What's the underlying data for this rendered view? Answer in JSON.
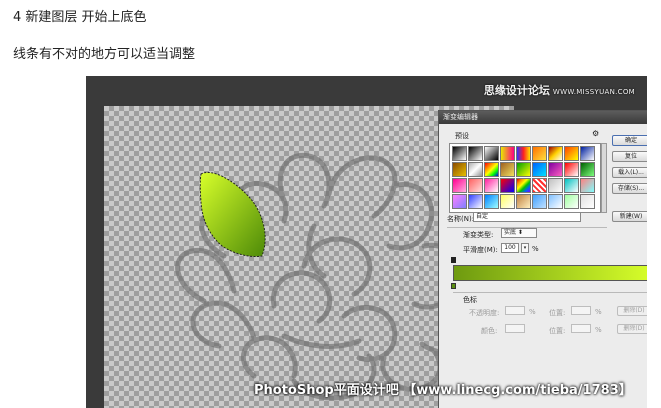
{
  "article": {
    "step_title": "4 新建图层 开始上底色",
    "step_desc": "线条有不对的地方可以适当调整"
  },
  "watermarks": {
    "top_main": "思缘设计论坛",
    "top_sub": "WWW.MISSYUAN.COM",
    "bottom": "PhotoShop平面设计吧 【www.linecg.com/tieba/1783】"
  },
  "dialog": {
    "title": "渐变编辑器",
    "presets_label": "预设",
    "gear_icon": "gear-icon",
    "preset_swatches": [
      "linear-gradient(135deg,#000,#fff)",
      "linear-gradient(135deg,#000,#ffffff00)",
      "linear-gradient(135deg,#fff,#000)",
      "linear-gradient(90deg,#e8e800,#ff0080)",
      "linear-gradient(90deg,#3030ff,#ff2020,#ffe000)",
      "linear-gradient(135deg,#ff7000,#ffe040)",
      "linear-gradient(135deg,#a00000,#ffd000,#ffffff)",
      "linear-gradient(135deg,#ff4000,#ffff00)",
      "linear-gradient(135deg,#0020a0,#ffffff)",
      "linear-gradient(135deg,#8a4a00,#e8c000)",
      "linear-gradient(135deg,#b0b0b0,#ffffff,#909090)",
      "linear-gradient(135deg,#ff0000,#ff8000,#ffff00,#00ff00,#0000ff)",
      "linear-gradient(135deg,#a06020,#f0e060)",
      "linear-gradient(135deg,#00a000,#ffff00)",
      "linear-gradient(135deg,#0060ff,#00e0ff)",
      "linear-gradient(135deg,#8000a0,#ff60c0)",
      "linear-gradient(135deg,#ff0000,#ffffff)",
      "linear-gradient(135deg,#006000,#80ff80)",
      "linear-gradient(135deg,#ff0090,#ffb0e0)",
      "linear-gradient(135deg,#ff6060,#ffe0e0)",
      "linear-gradient(135deg,#ff20a0,#ffffff)",
      "linear-gradient(135deg,#ff0000,#0000ff)",
      "linear-gradient(135deg,#e00000,#ff9000,#ffff00,#00c000,#0060ff,#8000ff)",
      "repeating-linear-gradient(45deg,#ff3030 0 2px,#ffffff 2px 4px)",
      "linear-gradient(135deg,#c0c0c0,#ffffff)",
      "linear-gradient(135deg,#00c0c0,#ffffff)",
      "linear-gradient(135deg,#ff8080,#80ffff)",
      "linear-gradient(135deg,#ff80ff,#8080ff)",
      "linear-gradient(135deg,#3040ff,#ffffff)",
      "linear-gradient(135deg,#0080ff,#a0ffff)",
      "linear-gradient(135deg,#ffff60,#ffffff)",
      "linear-gradient(135deg,#c08040,#fff0c0)",
      "linear-gradient(135deg,#40a0ff,#c0e0ff)",
      "linear-gradient(135deg,#80c0ff,#ffffff)",
      "linear-gradient(135deg,#a0ffa0,#ffffff)",
      "linear-gradient(135deg,#e0e0e0,#ffffff)"
    ],
    "buttons": {
      "ok": "确定",
      "cancel": "复位",
      "load": "载入(L)...",
      "save": "存储(S)...",
      "new": "新建(W)"
    },
    "name_label": "名称(N):",
    "name_value": "自定",
    "gradient_type_label": "渐变类型:",
    "gradient_type_value": "实底 ⬍",
    "smoothness_label": "平滑度(M):",
    "smoothness_value": "100",
    "smoothness_unit": "%",
    "gradient_colors": [
      "#6e9a10",
      "#d8ff2a"
    ],
    "stops_label": "色标",
    "opacity_label": "不透明度:",
    "location_label": "位置:",
    "color_label": "颜色:",
    "percent": "%",
    "delete_label": "删除(D)"
  }
}
